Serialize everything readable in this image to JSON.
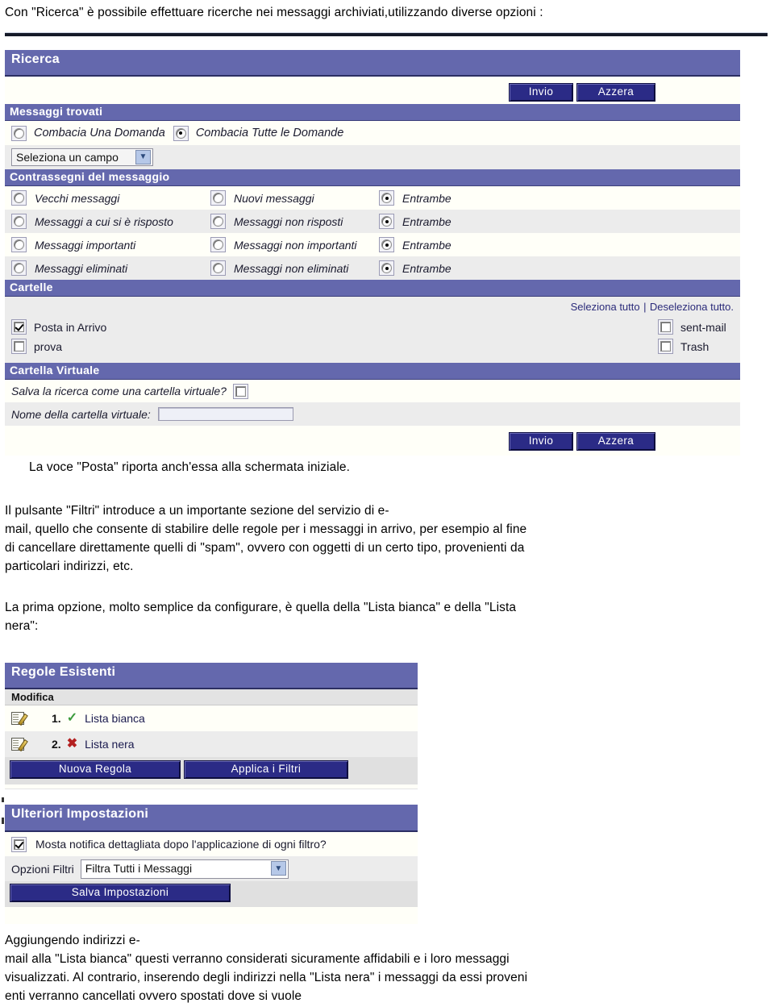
{
  "document": {
    "intro_paragraph": "Con \"Ricerca\" è possibile effettuare ricerche nei messaggi archiviati,utilizzando diverse opzioni :",
    "para_posta": "La voce \"Posta\" riporta anch'essa alla schermata iniziale.",
    "para_filtri_line1": "Il pulsante \"Filtri\" introduce a un importante sezione del servizio di e-",
    "para_filtri_line2": "mail, quello che consente di stabilire delle regole per i messaggi in arrivo, per esempio al fine",
    "para_filtri_line3": "di cancellare direttamente quelli di \"spam\", ovvero con oggetti di un certo tipo, provenienti da",
    "para_filtri_line4": " particolari indirizzi, etc.",
    "para_prima_opzione_line1": "La prima opzione, molto semplice da configurare, è quella della \"Lista bianca\" e della \"Lista",
    "para_prima_opzione_line2": "nera\":",
    "para_final_line1": "Aggiungendo indirizzi e-",
    "para_final_line2": "mail alla \"Lista bianca\" questi verranno considerati sicuramente affidabili e i loro messaggi",
    "para_final_line3": "visualizzati. Al contrario, inserendo degli indirizzi nella \"Lista nera\" i messaggi da essi proveni",
    "para_final_line4": "enti verranno cancellati ovvero spostati dove si vuole"
  },
  "colors": {
    "header_bar": "#6468ad",
    "button": "#2b2b86",
    "alt_row": "#ececec",
    "panel_bg": "#fffff8"
  },
  "search_screen": {
    "title": "Ricerca",
    "top_buttons": {
      "submit": "Invio",
      "reset": "Azzera"
    },
    "found_section": {
      "title": "Messaggi trovati",
      "option_any": {
        "label": "Combacia Una Domanda",
        "checked": false
      },
      "option_all": {
        "label": "Combacia Tutte le Domande",
        "checked": true
      },
      "field_select": {
        "value": "Seleziona un campo",
        "arrow_icon": "chevron-down-icon"
      }
    },
    "flags_section": {
      "title": "Contrassegni del messaggio",
      "rows": [
        {
          "left": "Vecchi messaggi",
          "middle": "Nuovi messaggi",
          "right": "Entrambe",
          "selected": "right"
        },
        {
          "left": "Messaggi a cui si è risposto",
          "middle": "Messaggi non risposti",
          "right": "Entrambe",
          "selected": "right"
        },
        {
          "left": "Messaggi importanti",
          "middle": "Messaggi non importanti",
          "right": "Entrambe",
          "selected": "right"
        },
        {
          "left": "Messaggi eliminati",
          "middle": "Messaggi non eliminati",
          "right": "Entrambe",
          "selected": "right"
        }
      ]
    },
    "folders_section": {
      "title": "Cartelle",
      "select_all": "Seleziona tutto",
      "separator": "|",
      "deselect_all": "Deseleziona tutto.",
      "left_folders": [
        {
          "name": "Posta in Arrivo",
          "checked": true
        },
        {
          "name": "prova",
          "checked": false
        }
      ],
      "right_folders": [
        {
          "name": "sent-mail",
          "checked": false
        },
        {
          "name": "Trash",
          "checked": false
        }
      ]
    },
    "virtual_folder_section": {
      "title": "Cartella Virtuale",
      "save_question": "Salva la ricerca come una cartella virtuale?",
      "save_checked": false,
      "name_label": "Nome della cartella virtuale:",
      "name_value": ""
    },
    "bottom_buttons": {
      "submit": "Invio",
      "reset": "Azzera"
    }
  },
  "rules_screen": {
    "title": "Regole Esistenti",
    "column_header": "Modifica",
    "rules": [
      {
        "edit_icon": "edit-pencil-icon",
        "number": "1.",
        "status_icon": "green-check-icon",
        "label": "Lista bianca"
      },
      {
        "edit_icon": "edit-pencil-icon",
        "number": "2.",
        "status_icon": "red-cross-icon",
        "label": "Lista nera"
      }
    ],
    "buttons": {
      "new_rule": "Nuova Regola",
      "apply_filters": "Applica i Filtri"
    }
  },
  "settings_screen": {
    "title": "Ulteriori Impostazioni",
    "notify_label": "Mosta notifica dettagliata dopo l'applicazione di ogni filtro?",
    "notify_checked": true,
    "filter_options_label": "Opzioni Filtri",
    "filter_options_value": "Filtra Tutti i Messaggi",
    "filter_options_arrow": "chevron-down-icon",
    "save_button": "Salva Impostazioni"
  }
}
